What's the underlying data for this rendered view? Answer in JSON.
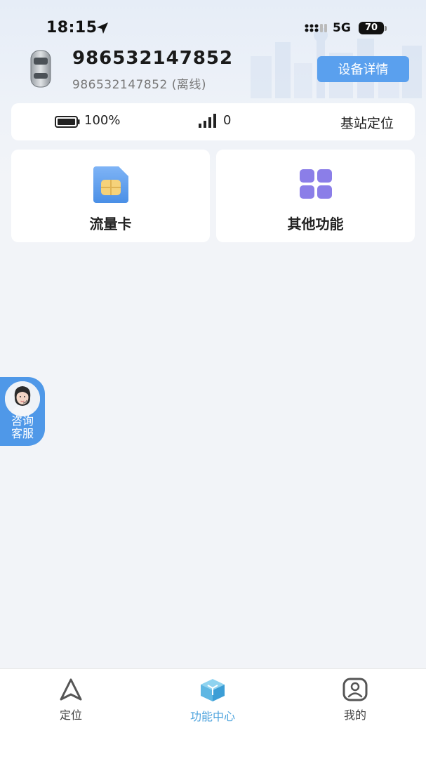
{
  "status_bar": {
    "time": "18:15",
    "network": "5G",
    "battery": "70"
  },
  "device": {
    "id": "986532147852",
    "subtitle": "986532147852 (离线)",
    "detail_button": "设备详情"
  },
  "info": {
    "battery_value": "100%",
    "signal_value": "0",
    "station_locate": "基站定位"
  },
  "features": [
    {
      "label": "流量卡",
      "icon": "sim-card-icon"
    },
    {
      "label": "其他功能",
      "icon": "grid-icon"
    }
  ],
  "service": {
    "label_line1": "咨询",
    "label_line2": "客服"
  },
  "nav": {
    "items": [
      {
        "label": "定位",
        "icon": "navigation-arrow-icon"
      },
      {
        "label": "功能中心",
        "icon": "cube-icon",
        "active": true
      },
      {
        "label": "我的",
        "icon": "profile-icon"
      }
    ]
  },
  "colors": {
    "accent": "#5aa0ee",
    "nav_active": "#4da3dd",
    "feature_purple": "#8b7ee8"
  }
}
